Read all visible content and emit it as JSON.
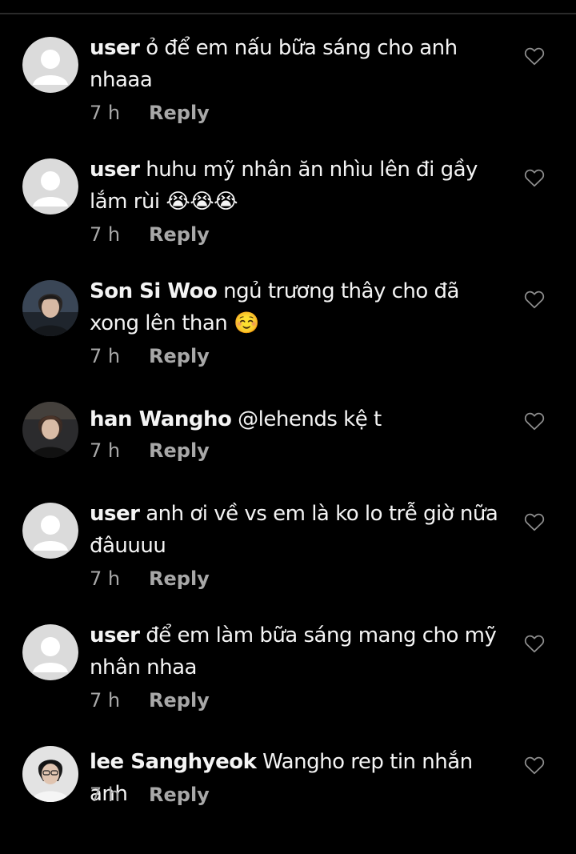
{
  "colors": {
    "background": "#000000",
    "text": "#f4f4f4",
    "meta": "#a8a8a8",
    "default_avatar_bg": "#dbdbdb"
  },
  "comments": [
    {
      "username": "user",
      "text": "ỏ để em nấu bữa sáng cho anh nhaaa",
      "time": "7 h",
      "reply_label": "Reply",
      "avatar": "default-avatar",
      "like_icon": "heart-outline-icon"
    },
    {
      "username": "user",
      "text": "huhu mỹ nhân ăn nhìu lên đi gầy lắm rùi 😭😭😭",
      "time": "7 h",
      "reply_label": "Reply",
      "avatar": "default-avatar",
      "like_icon": "heart-outline-icon"
    },
    {
      "username": "Son Si Woo",
      "text": "ngủ trương thây cho đã xong lên than ☺️",
      "time": "7 h",
      "reply_label": "Reply",
      "avatar": "photo-avatar",
      "like_icon": "heart-outline-icon"
    },
    {
      "username": "han Wangho",
      "text": "@lehends kệ t",
      "time": "7 h",
      "reply_label": "Reply",
      "avatar": "photo-avatar",
      "like_icon": "heart-outline-icon"
    },
    {
      "username": "user",
      "text": "anh ơi về vs em là ko lo trễ giờ nữa đâuuuu",
      "time": "7 h",
      "reply_label": "Reply",
      "avatar": "default-avatar",
      "like_icon": "heart-outline-icon"
    },
    {
      "username": "user",
      "text": "để em làm bữa sáng mang cho mỹ nhân nhaa",
      "time": "7 h",
      "reply_label": "Reply",
      "avatar": "default-avatar",
      "like_icon": "heart-outline-icon"
    },
    {
      "username": "lee Sanghyeok",
      "text": "Wangho rep tin nhắn anh",
      "time": "7 h",
      "reply_label": "Reply",
      "avatar": "photo-avatar",
      "like_icon": "heart-outline-icon"
    }
  ]
}
